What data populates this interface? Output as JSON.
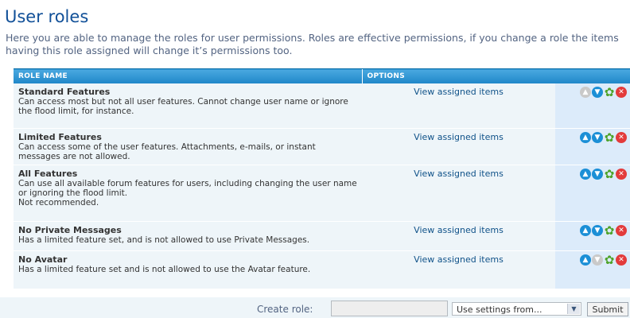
{
  "page": {
    "title": "User roles",
    "intro": "Here you are able to manage the roles for user permissions. Roles are effective permissions, if you change a role the items having this role assigned will change it’s permissions too."
  },
  "table": {
    "headers": {
      "role_name": "ROLE NAME",
      "options": "OPTIONS"
    },
    "rows": [
      {
        "name": "Standard Features",
        "description": "Can access most but not all user features. Cannot change user name or ignore the flood limit, for instance.",
        "view_label": "View assigned items",
        "move_up_enabled": false,
        "move_down_enabled": true
      },
      {
        "name": "Limited Features",
        "description": "Can access some of the user features. Attachments, e-mails, or instant messages are not allowed.",
        "view_label": "View assigned items",
        "move_up_enabled": true,
        "move_down_enabled": true
      },
      {
        "name": "All Features",
        "description": "Can use all available forum features for users, including changing the user name or ignoring the flood limit.\nNot recommended.",
        "view_label": "View assigned items",
        "move_up_enabled": true,
        "move_down_enabled": true
      },
      {
        "name": "No Private Messages",
        "description": "Has a limited feature set, and is not allowed to use Private Messages.",
        "view_label": "View assigned items",
        "move_up_enabled": true,
        "move_down_enabled": true
      },
      {
        "name": "No Avatar",
        "description": "Has a limited feature set and is not allowed to use the Avatar feature.",
        "view_label": "View assigned items",
        "move_up_enabled": true,
        "move_down_enabled": false
      }
    ],
    "icons": {
      "move_up": "move-up-icon",
      "move_down": "move-down-icon",
      "edit": "gear-icon",
      "delete": "delete-icon"
    }
  },
  "footer": {
    "create_label": "Create role:",
    "create_value": "",
    "settings_selected": "Use settings from...",
    "submit_label": "Submit"
  },
  "colors": {
    "title": "#115098",
    "header_bg": "#1f86c8",
    "row_bg": "#eef5f9",
    "action_bg": "#dcebfa",
    "icon_blue": "#1b8fd6",
    "icon_disabled": "#c9c9c9",
    "icon_green": "#4ea32a",
    "icon_red": "#e33b3b"
  }
}
